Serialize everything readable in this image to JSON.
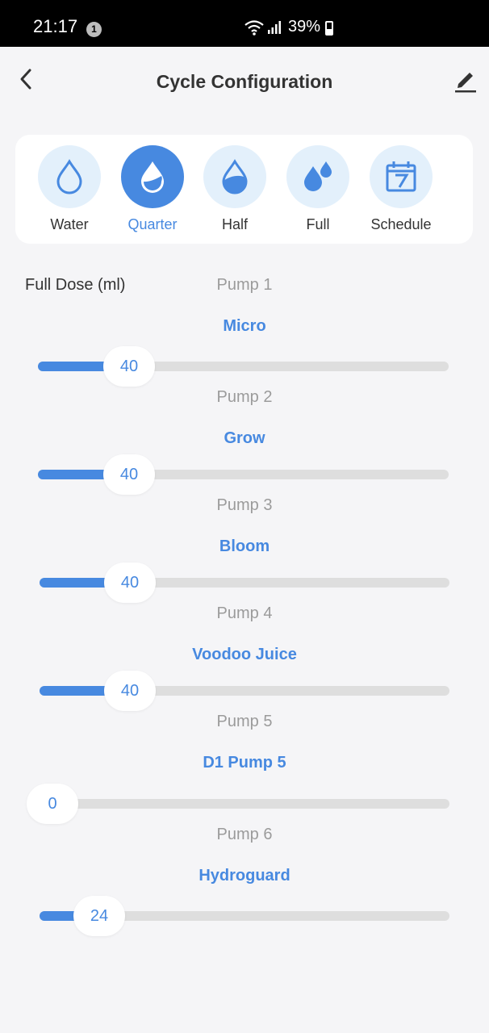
{
  "status_bar": {
    "time": "21:17",
    "notification_count": "1",
    "battery": "39%"
  },
  "header": {
    "title": "Cycle Configuration"
  },
  "modes": [
    {
      "label": "Water",
      "icon": "water-drop-outline-icon",
      "active": false
    },
    {
      "label": "Quarter",
      "icon": "quarter-drop-icon",
      "active": true
    },
    {
      "label": "Half",
      "icon": "half-drop-icon",
      "active": false
    },
    {
      "label": "Full",
      "icon": "full-drops-icon",
      "active": false
    },
    {
      "label": "Schedule",
      "icon": "calendar-7-icon",
      "active": false
    }
  ],
  "dose_label": "Full Dose (ml)",
  "pumps": [
    {
      "title": "Pump 1",
      "name": "Micro",
      "value": "40"
    },
    {
      "title": "Pump 2",
      "name": "Grow",
      "value": "40"
    },
    {
      "title": "Pump 3",
      "name": "Bloom",
      "value": "40"
    },
    {
      "title": "Pump 4",
      "name": "Voodoo Juice",
      "value": "40"
    },
    {
      "title": "Pump 5",
      "name": "D1 Pump 5",
      "value": "0"
    },
    {
      "title": "Pump 6",
      "name": "Hydroguard",
      "value": "24"
    }
  ],
  "colors": {
    "accent": "#4789e0",
    "accent_light": "#e3f0fb",
    "track": "#dedede"
  }
}
